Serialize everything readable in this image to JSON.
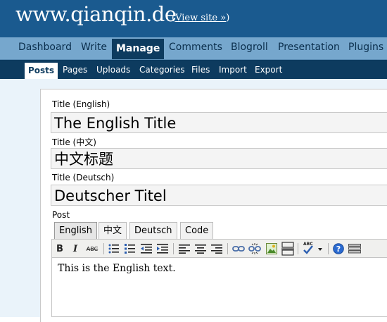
{
  "header": {
    "site_name": "www.qianqin.de",
    "view_site": "View site »"
  },
  "main_nav": {
    "dashboard": "Dashboard",
    "write": "Write",
    "manage": "Manage",
    "comments": "Comments",
    "blogroll": "Blogroll",
    "presentation": "Presentation",
    "plugins": "Plugins"
  },
  "sub_nav": {
    "posts": "Posts",
    "pages": "Pages",
    "uploads": "Uploads",
    "categories": "Categories",
    "files": "Files",
    "import": "Import",
    "export": "Export"
  },
  "form": {
    "title_en_label": "Title (English)",
    "title_en_value": "The English Title",
    "title_zh_label": "Title (中文)",
    "title_zh_value": "中文标题",
    "title_de_label": "Title (Deutsch)",
    "title_de_value": "Deutscher Titel",
    "post_label": "Post"
  },
  "language_tabs": {
    "english": "English",
    "chinese": "中文",
    "deutsch": "Deutsch",
    "code": "Code"
  },
  "toolbar": {
    "bold": "B",
    "italic": "I",
    "strikethrough": "ABC",
    "spellcheck": "ABC",
    "icons": [
      "bold-icon",
      "italic-icon",
      "strikethrough-icon",
      "bullet-list-icon",
      "numbered-list-icon",
      "outdent-icon",
      "indent-icon",
      "align-left-icon",
      "align-center-icon",
      "align-right-icon",
      "link-icon",
      "unlink-icon",
      "image-icon",
      "more-break-icon",
      "spellcheck-icon",
      "help-icon",
      "kitchen-sink-icon"
    ]
  },
  "editor": {
    "text": "This is the English text."
  },
  "colors": {
    "header_bg": "#1a5a8f",
    "main_nav_bg": "#76a7cd",
    "sub_nav_bg": "#0d3b5f",
    "content_bg": "#eaf3fa"
  }
}
